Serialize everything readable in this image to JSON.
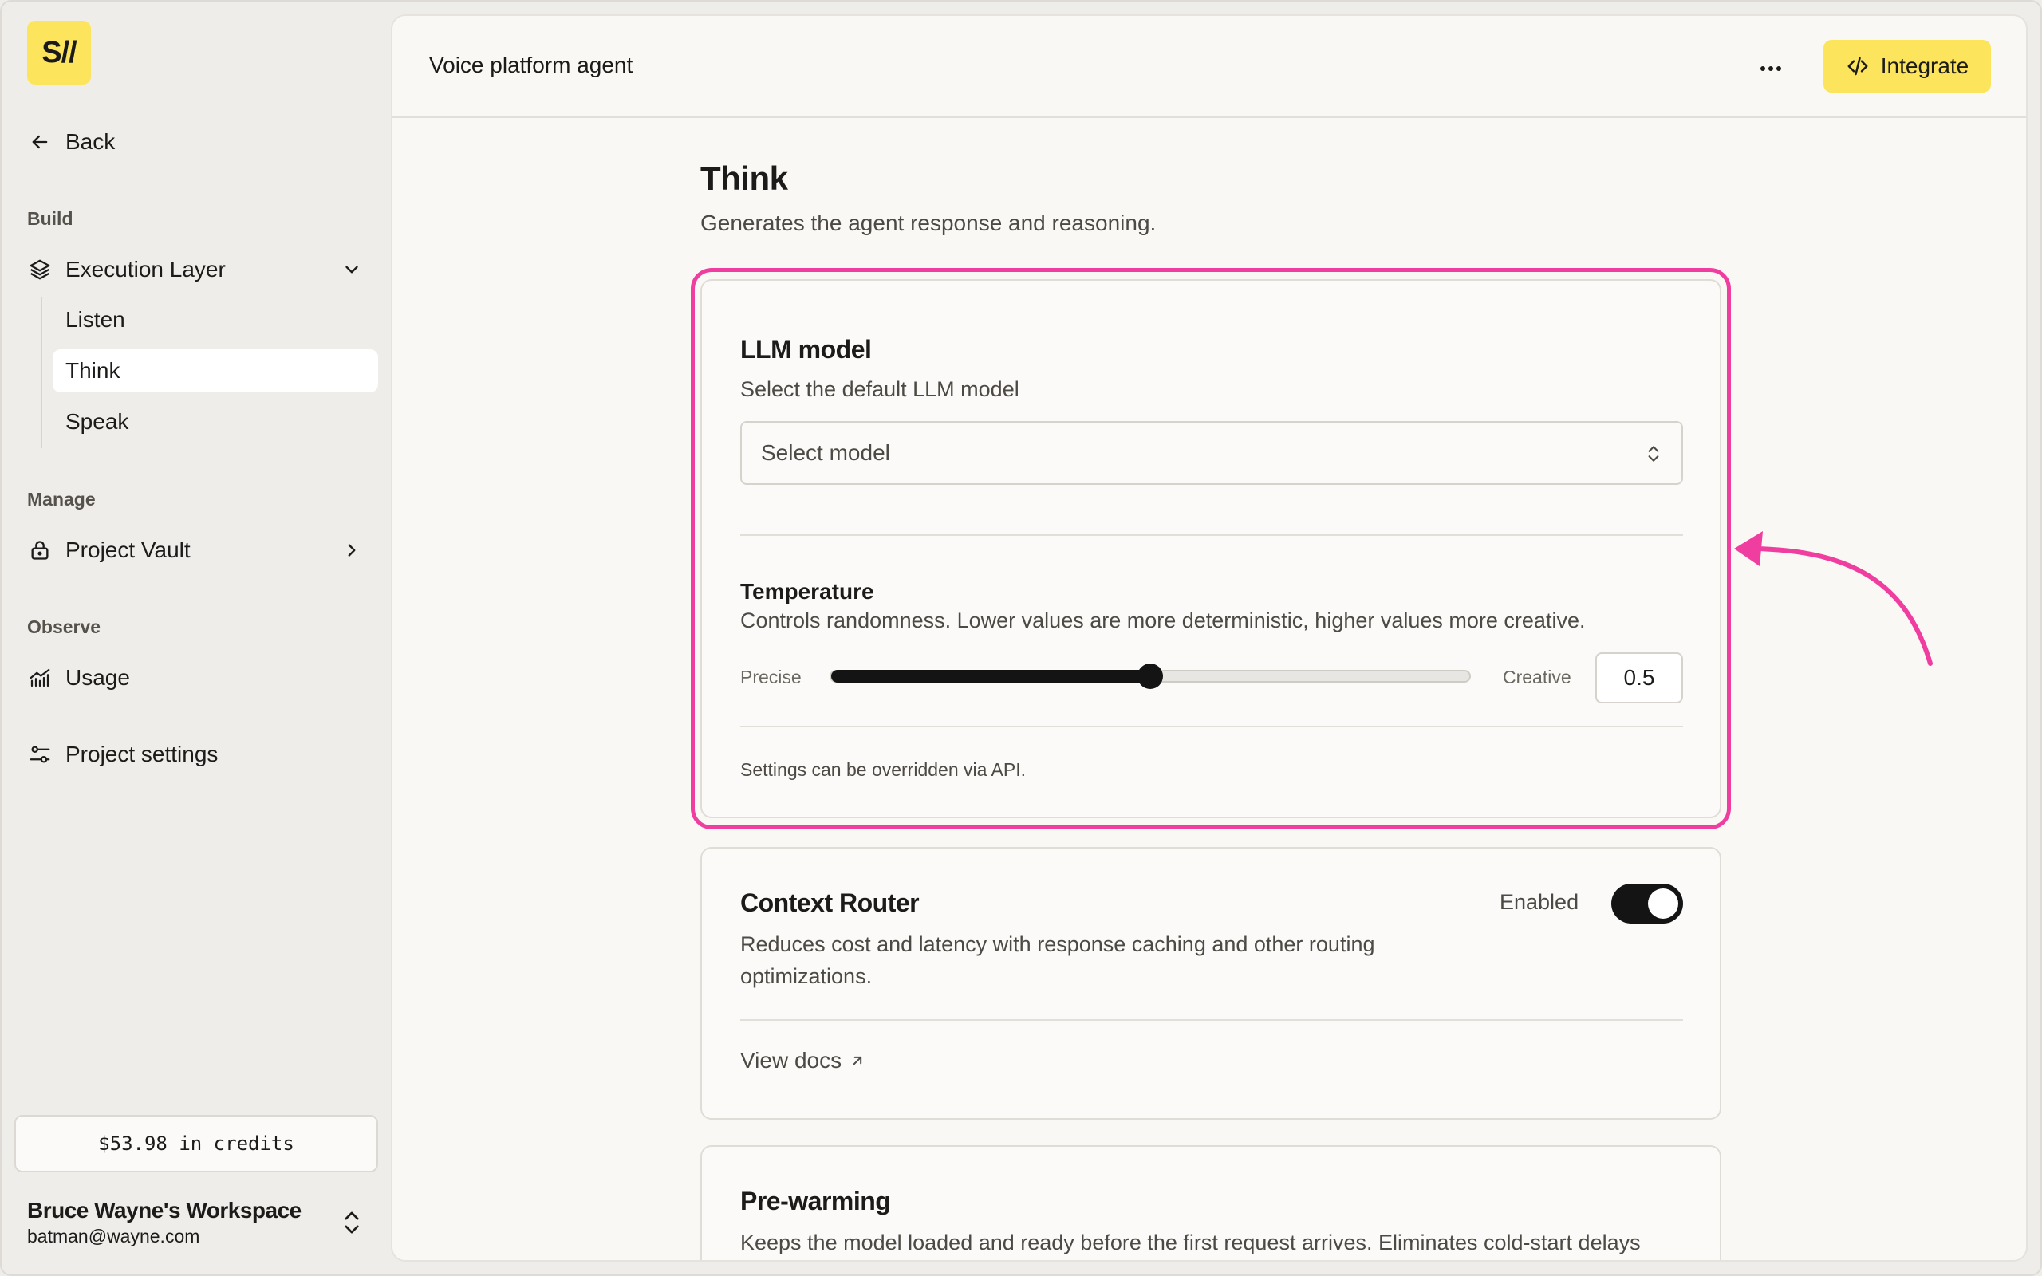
{
  "sidebar": {
    "logo_text": "S//",
    "back_label": "Back",
    "build_label": "Build",
    "execution_layer_label": "Execution Layer",
    "sub_items": [
      {
        "label": "Listen"
      },
      {
        "label": "Think"
      },
      {
        "label": "Speak"
      }
    ],
    "manage_label": "Manage",
    "project_vault_label": "Project Vault",
    "observe_label": "Observe",
    "usage_label": "Usage",
    "project_settings_label": "Project settings",
    "credits_text": "$53.98 in credits",
    "workspace_name": "Bruce Wayne's Workspace",
    "workspace_email": "batman@wayne.com"
  },
  "header": {
    "title": "Voice platform agent",
    "integrate_label": "Integrate"
  },
  "page": {
    "title": "Think",
    "subtitle": "Generates the agent response and reasoning."
  },
  "llm_card": {
    "title": "LLM model",
    "description": "Select the default LLM model",
    "select_placeholder": "Select model",
    "temperature_title": "Temperature",
    "temperature_desc": "Controls randomness. Lower values are more deterministic, higher values more creative.",
    "min_label": "Precise",
    "max_label": "Creative",
    "temperature_value": "0.5",
    "temperature_fraction": 0.5,
    "note": "Settings can be overridden via API."
  },
  "context_card": {
    "title": "Context Router",
    "description": "Reduces cost and latency with response caching and other routing optimizations.",
    "toggle_label": "Enabled",
    "toggle_on": true,
    "docs_label": "View docs"
  },
  "prewarm_card": {
    "title": "Pre-warming",
    "description": "Keeps the model loaded and ready before the first request arrives. Eliminates cold-start delays"
  },
  "colors": {
    "accent": "#fce55c",
    "highlight": "#f03ea0",
    "dark": "#141414"
  }
}
